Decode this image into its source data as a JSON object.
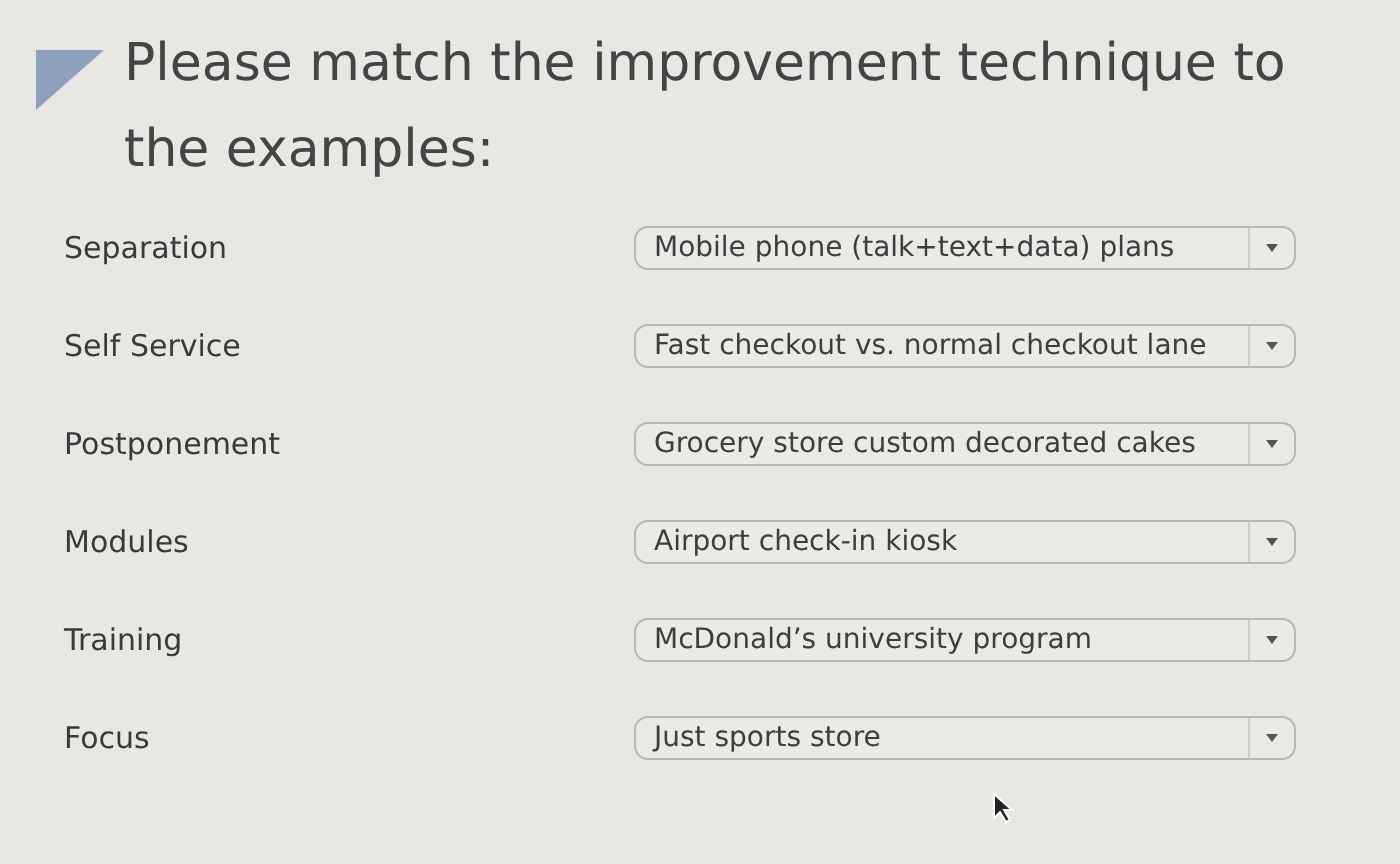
{
  "question": {
    "prompt": "Please match the improvement technique to the examples:"
  },
  "pairs": [
    {
      "term": "Separation",
      "answer": "Mobile phone (talk+text+data) plans"
    },
    {
      "term": "Self Service",
      "answer": "Fast checkout vs. normal checkout lane"
    },
    {
      "term": "Postponement",
      "answer": "Grocery store custom decorated cakes"
    },
    {
      "term": "Modules",
      "answer": "Airport check-in kiosk"
    },
    {
      "term": "Training",
      "answer": "McDonald’s university program"
    },
    {
      "term": "Focus",
      "answer": "Just sports store"
    }
  ]
}
